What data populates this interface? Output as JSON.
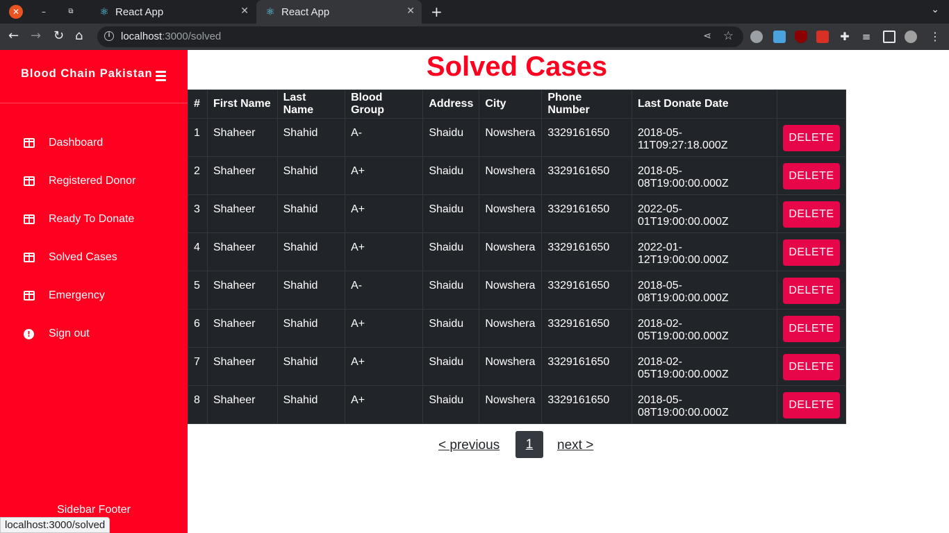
{
  "browser": {
    "tabs": [
      {
        "title": "React App",
        "active": false
      },
      {
        "title": "React App",
        "active": true
      }
    ],
    "url_host": "localhost",
    "url_path": ":3000/solved",
    "status_text": "localhost:3000/solved"
  },
  "sidebar": {
    "brand": "Blood Chain Pakistan",
    "items": [
      {
        "label": "Dashboard",
        "icon": "table-icon"
      },
      {
        "label": "Registered Donor",
        "icon": "table-icon"
      },
      {
        "label": "Ready To Donate",
        "icon": "table-icon"
      },
      {
        "label": "Solved Cases",
        "icon": "table-icon"
      },
      {
        "label": "Emergency",
        "icon": "table-icon"
      },
      {
        "label": "Sign out",
        "icon": "alert-icon"
      }
    ],
    "footer": "Sidebar Footer"
  },
  "main": {
    "title": "Solved Cases",
    "table": {
      "headers": [
        "#",
        "First Name",
        "Last Name",
        "Blood Group",
        "Address",
        "City",
        "Phone Number",
        "Last Donate Date",
        ""
      ],
      "rows": [
        [
          "1",
          "Shaheer",
          "Shahid",
          "A-",
          "Shaidu",
          "Nowshera",
          "3329161650",
          "2018-05-11T09:27:18.000Z"
        ],
        [
          "2",
          "Shaheer",
          "Shahid",
          "A+",
          "Shaidu",
          "Nowshera",
          "3329161650",
          "2018-05-08T19:00:00.000Z"
        ],
        [
          "3",
          "Shaheer",
          "Shahid",
          "A+",
          "Shaidu",
          "Nowshera",
          "3329161650",
          "2022-05-01T19:00:00.000Z"
        ],
        [
          "4",
          "Shaheer",
          "Shahid",
          "A+",
          "Shaidu",
          "Nowshera",
          "3329161650",
          "2022-01-12T19:00:00.000Z"
        ],
        [
          "5",
          "Shaheer",
          "Shahid",
          "A-",
          "Shaidu",
          "Nowshera",
          "3329161650",
          "2018-05-08T19:00:00.000Z"
        ],
        [
          "6",
          "Shaheer",
          "Shahid",
          "A+",
          "Shaidu",
          "Nowshera",
          "3329161650",
          "2018-02-05T19:00:00.000Z"
        ],
        [
          "7",
          "Shaheer",
          "Shahid",
          "A+",
          "Shaidu",
          "Nowshera",
          "3329161650",
          "2018-02-05T19:00:00.000Z"
        ],
        [
          "8",
          "Shaheer",
          "Shahid",
          "A+",
          "Shaidu",
          "Nowshera",
          "3329161650",
          "2018-05-08T19:00:00.000Z"
        ]
      ],
      "delete_label": "DELETE"
    },
    "pagination": {
      "previous": "< previous",
      "current": "1",
      "next": "next >"
    }
  },
  "colors": {
    "sidebar_bg": "#ff0020",
    "title_color": "#ff0020",
    "table_bg": "#212529",
    "delete_bg": "#e8064b"
  }
}
